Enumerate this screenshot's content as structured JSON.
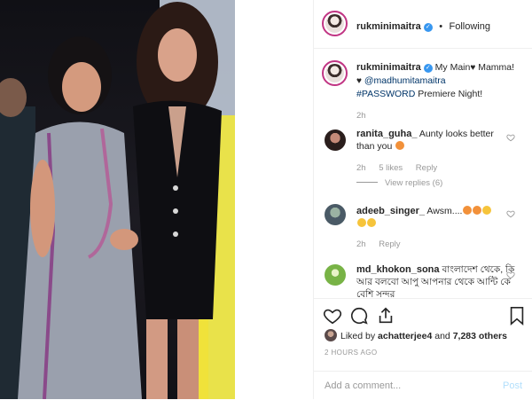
{
  "header": {
    "username": "rukminimaitra",
    "separator": "•",
    "follow_status": "Following"
  },
  "caption": {
    "username": "rukminimaitra",
    "line1": "My Main",
    "line1_tail": "Mamma!",
    "mention": "@madhumitamaitra",
    "hashtag": "#PASSWORD",
    "hashtag_tail": " Premiere Night!",
    "time": "2h"
  },
  "comments": [
    {
      "username": "ranita_guha_",
      "text": "Aunty looks better than you",
      "time": "2h",
      "likes": "5 likes",
      "reply": "Reply",
      "view_replies": "View replies (6)"
    },
    {
      "username": "adeeb_singer_",
      "text": "Awsm....",
      "time": "2h",
      "reply": "Reply"
    },
    {
      "username": "md_khokon_sona",
      "text": "বাংলাদেশ থেকে, কি আর বলবো আপু আপনার থেকে আন্টি কে বেশি সুন্দর"
    }
  ],
  "likes": {
    "prefix": "Liked by ",
    "user": "achatterjee4",
    "middle": " and ",
    "count": "7,283 others"
  },
  "time_ago": "2 HOURS AGO",
  "add_comment": {
    "placeholder": "Add a comment...",
    "post_label": "Post"
  },
  "icons": {
    "like": "heart-icon",
    "comment": "comment-icon",
    "share": "share-icon",
    "save": "bookmark-icon",
    "verified": "verified-badge-icon"
  },
  "colors": {
    "link": "#003569",
    "muted": "#999999",
    "verified": "#3897f0",
    "post_disabled": "#b2dffc"
  }
}
